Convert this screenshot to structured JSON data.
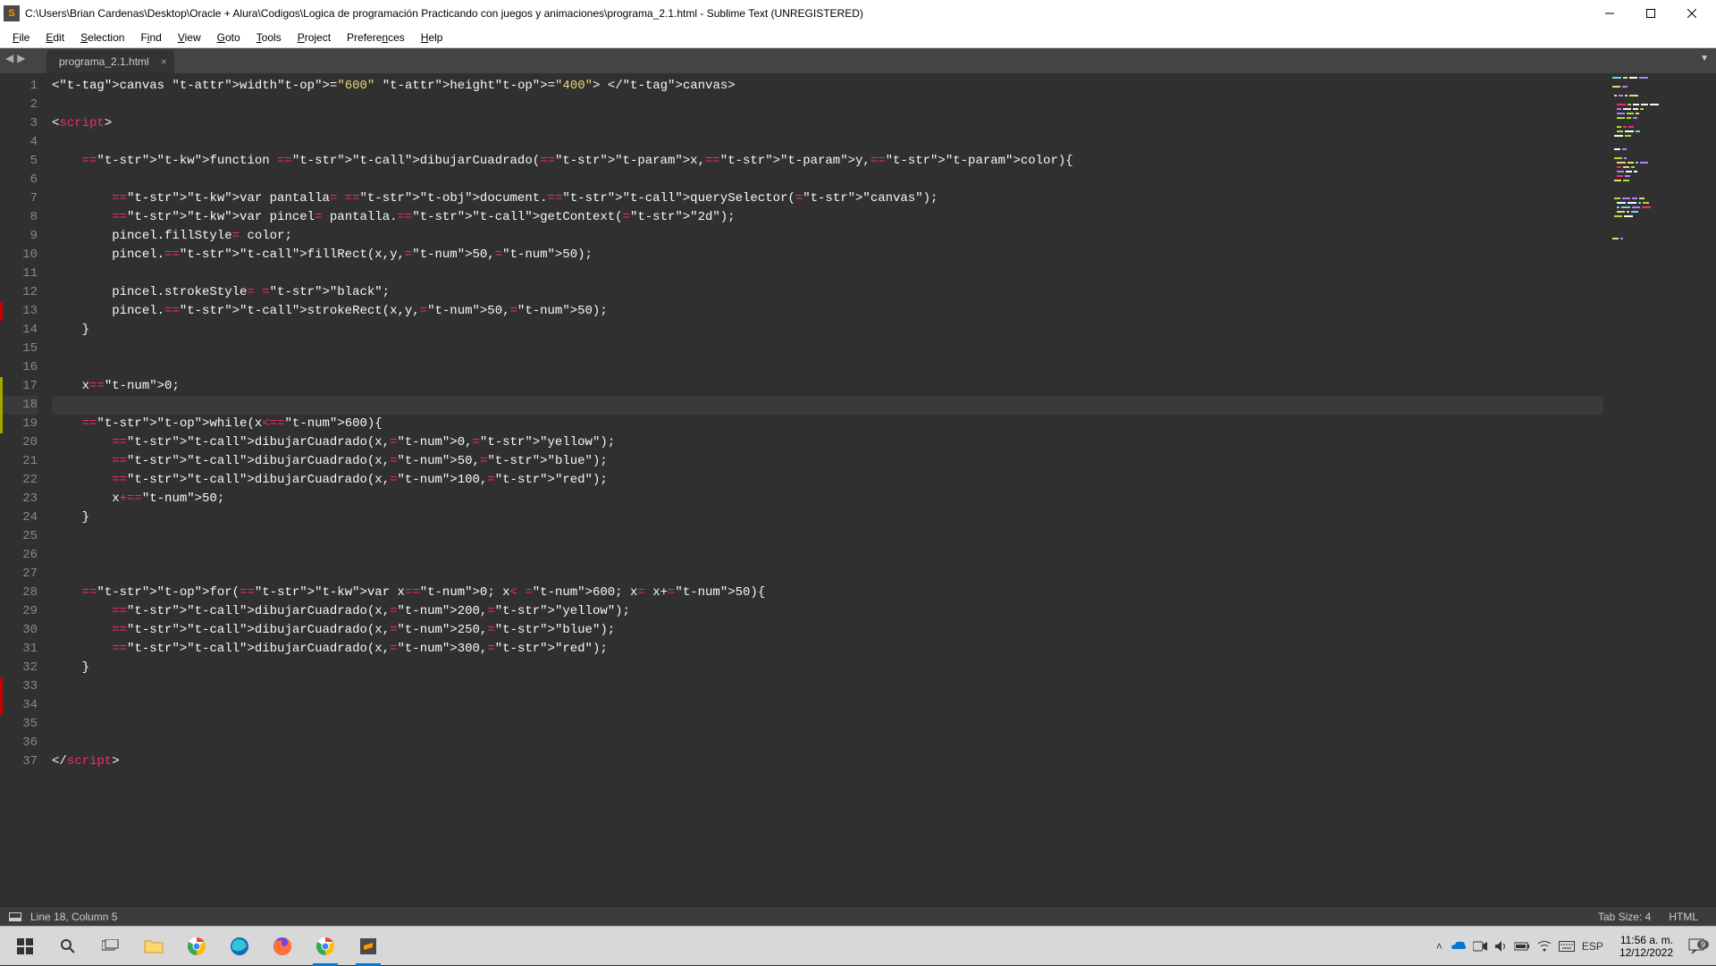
{
  "window": {
    "title": "C:\\Users\\Brian Cardenas\\Desktop\\Oracle + Alura\\Codigos\\Logica de programación Practicando con juegos y animaciones\\programa_2.1.html - Sublime Text (UNREGISTERED)",
    "app_icon_letter": "S"
  },
  "menus": {
    "file": "File",
    "edit": "Edit",
    "selection": "Selection",
    "find": "Find",
    "view": "View",
    "goto": "Goto",
    "tools": "Tools",
    "project": "Project",
    "preferences": "Preferences",
    "help": "Help"
  },
  "tab": {
    "label": "programa_2.1.html"
  },
  "statusbar": {
    "position": "Line 18, Column 5",
    "tab_size": "Tab Size: 4",
    "syntax": "HTML"
  },
  "code": {
    "current_line": 18,
    "line_count": 37,
    "modified_markers": [
      17,
      18,
      19
    ],
    "error_markers": [
      13,
      33,
      34
    ],
    "lines_raw": [
      "<canvas width=\"600\" height=\"400\"> </canvas>",
      "",
      "<script>",
      "",
      "    function dibujarCuadrado(x,y,color){",
      "",
      "        var pantalla= document.querySelector(\"canvas\");",
      "        var pincel= pantalla.getContext(\"2d\");",
      "        pincel.fillStyle= color;",
      "        pincel.fillRect(x,y,50,50);",
      "",
      "        pincel.strokeStyle= \"black\";",
      "        pincel.strokeRect(x,y,50,50);",
      "    }",
      "",
      "",
      "    x=0;",
      "    ",
      "    while(x<=600){",
      "        dibujarCuadrado(x,0,\"yellow\");",
      "        dibujarCuadrado(x,50,\"blue\");",
      "        dibujarCuadrado(x,100,\"red\");",
      "        x+=50;",
      "    }",
      "",
      "",
      "",
      "    for(var x=0; x< 600; x= x+50){",
      "        dibujarCuadrado(x,200,\"yellow\");",
      "        dibujarCuadrado(x,250,\"blue\");",
      "        dibujarCuadrado(x,300,\"red\");",
      "    }",
      "",
      "",
      "",
      "",
      "</script>"
    ]
  },
  "tray": {
    "lang": "ESP"
  },
  "clock": {
    "time": "11:56 a. m.",
    "date": "12/12/2022"
  },
  "notif_badge": "9"
}
